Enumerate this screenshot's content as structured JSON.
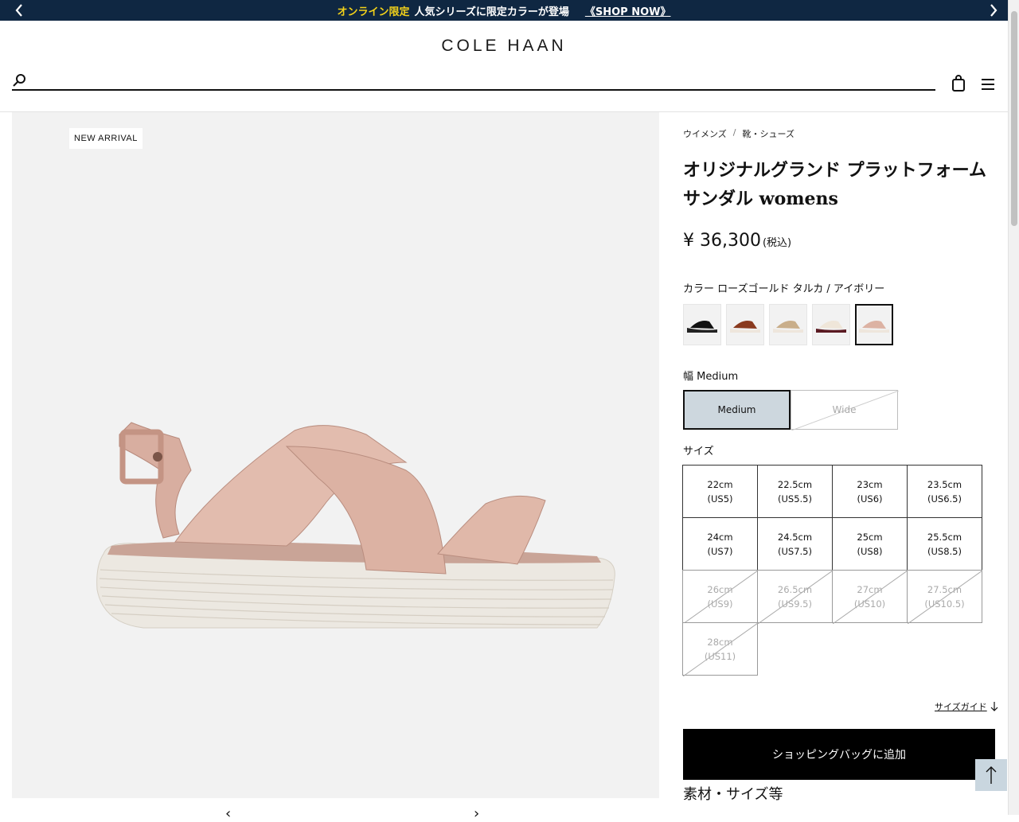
{
  "promo": {
    "highlight": "オンライン限定",
    "text": "人気シリーズに限定カラーが登場",
    "link": "《SHOP NOW》"
  },
  "brand": "COLE HAAN",
  "search": {
    "placeholder": ""
  },
  "gallery": {
    "badge": "NEW ARRIVAL"
  },
  "breadcrumb": {
    "items": [
      "ウイメンズ",
      "靴・シューズ"
    ],
    "separator": "/"
  },
  "product": {
    "title": "オリジナルグランド プラットフォーム サンダル womens",
    "price": "¥ 36,300",
    "tax_note": "(税込)"
  },
  "color": {
    "label": "カラー ローズゴールド タルカ / アイボリー",
    "swatches": [
      "black",
      "brown",
      "gold-beige",
      "ivory-burgundy",
      "rose-gold"
    ],
    "selected_index": 4
  },
  "width": {
    "label": "幅 Medium",
    "options": [
      {
        "label": "Medium",
        "selected": true,
        "available": true
      },
      {
        "label": "Wide",
        "selected": false,
        "available": false
      }
    ]
  },
  "size": {
    "label": "サイズ",
    "options": [
      {
        "cm": "22cm",
        "us": "(US5)",
        "available": true
      },
      {
        "cm": "22.5cm",
        "us": "(US5.5)",
        "available": true
      },
      {
        "cm": "23cm",
        "us": "(US6)",
        "available": true
      },
      {
        "cm": "23.5cm",
        "us": "(US6.5)",
        "available": true
      },
      {
        "cm": "24cm",
        "us": "(US7)",
        "available": true
      },
      {
        "cm": "24.5cm",
        "us": "(US7.5)",
        "available": true
      },
      {
        "cm": "25cm",
        "us": "(US8)",
        "available": true
      },
      {
        "cm": "25.5cm",
        "us": "(US8.5)",
        "available": true
      },
      {
        "cm": "26cm",
        "us": "(US9)",
        "available": false
      },
      {
        "cm": "26.5cm",
        "us": "(US9.5)",
        "available": false
      },
      {
        "cm": "27cm",
        "us": "(US10)",
        "available": false
      },
      {
        "cm": "27.5cm",
        "us": "(US10.5)",
        "available": false
      },
      {
        "cm": "28cm",
        "us": "(US11)",
        "available": false
      }
    ]
  },
  "size_guide": "サイズガイド",
  "add_to_bag": "ショッピングバッグに追加",
  "materials_heading": "素材・サイズ等",
  "colors": {
    "promo_bg": "#0f2742",
    "promo_highlight": "#f3d21a",
    "selected_width_bg": "#cdd7de"
  }
}
